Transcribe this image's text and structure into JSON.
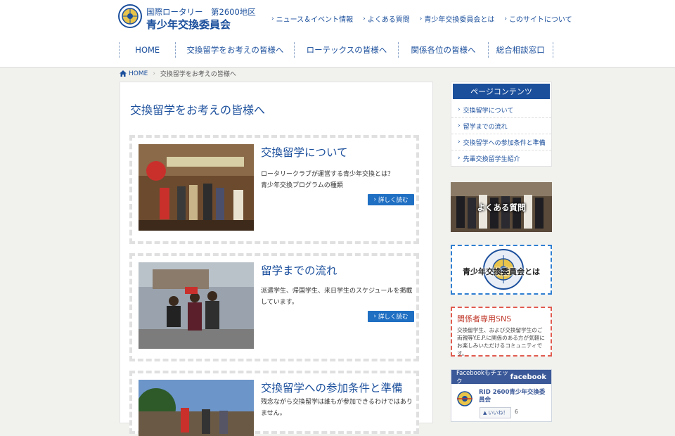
{
  "logo": {
    "line1": "国際ロータリー　第2600地区",
    "line2": "青少年交換委員会",
    "emblem": "rotary-emblem-icon"
  },
  "toplinks": [
    {
      "label": "ニュース＆イベント情報"
    },
    {
      "label": "よくある質問"
    },
    {
      "label": "青少年交換委員会とは"
    },
    {
      "label": "このサイトについて"
    }
  ],
  "gnav": [
    {
      "label": "HOME"
    },
    {
      "label": "交換留学をお考えの皆様へ"
    },
    {
      "label": "ローテックスの皆様へ"
    },
    {
      "label": "関係各位の皆様へ"
    },
    {
      "label": "総合相談窓口"
    }
  ],
  "breadcrumb": {
    "home": "HOME",
    "current": "交換留学をお考えの皆様へ"
  },
  "main": {
    "title": "交換留学をお考えの皆様へ",
    "cards": [
      {
        "title": "交換留学について",
        "desc1": "ロータリークラブが運営する青少年交換とは？",
        "desc2": "青少年交換プログラムの種類",
        "button": "詳しく読む"
      },
      {
        "title": "留学までの流れ",
        "desc1": "派遣学生、帰国学生、来日学生のスケジュールを掲載しています。",
        "button": "詳しく読む"
      },
      {
        "title": "交換留学への参加条件と準備",
        "desc1": "残念ながら交換留学は誰もが参加できるわけではありません。"
      }
    ]
  },
  "side": {
    "heading": "ページコンテンツ",
    "items": [
      "交換留学について",
      "留学までの流れ",
      "交換留学への参加条件と準備",
      "先輩交換留学生紹介"
    ],
    "faq_banner": "よくある質問",
    "committee_banner": "青少年交換委員会とは",
    "sns_title": "関係者専用SNS",
    "sns_desc": "交換留学生、および交換留学生のご両親等Y.E.P.に関係のある方が気軽にお楽しみいただけるコミュニティです。",
    "fb_check": "Facebookもチェック",
    "fb_brand": "facebook",
    "fb_page": "RID 2600青少年交換委員会",
    "fb_like": "いいね！",
    "fb_count": "6"
  },
  "colors": {
    "brand": "#1b4f9c",
    "button": "#1f6fc3",
    "sns": "#c0392b",
    "facebook": "#3b5998"
  }
}
